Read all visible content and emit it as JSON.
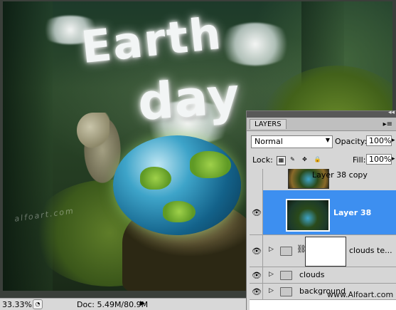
{
  "canvas": {
    "title_line1": "Earth",
    "title_line2": "day",
    "watermark": "alfoart.com"
  },
  "statusbar": {
    "zoom": "33.33%",
    "doc": "Doc: 5.49M/80.9M",
    "arrow": "▶"
  },
  "layers_panel": {
    "collapse_icon": "◂◂",
    "tab_label": "LAYERS",
    "menu_icon": "▸≡",
    "blend_mode": "Normal",
    "blend_caret": "▼",
    "opacity_label": "Opacity:",
    "opacity_value": "100%",
    "opacity_caret": "▸",
    "lock_label": "Lock:",
    "fill_label": "Fill:",
    "fill_value": "100%",
    "fill_caret": "▸",
    "layers": [
      {
        "name": "Layer 38 copy",
        "visible": false,
        "selected": false
      },
      {
        "name": "Layer 38",
        "visible": true,
        "selected": true
      },
      {
        "name": "clouds te...",
        "visible": true,
        "selected": false
      },
      {
        "name": "clouds",
        "visible": true,
        "selected": false
      },
      {
        "name": "background",
        "visible": true,
        "selected": false
      }
    ],
    "eye_glyph": "👁"
  },
  "footer_watermark": "www.Alfoart.com",
  "colors": {
    "selection": "#3d8ff0",
    "panel_bg": "#d6d6d6"
  }
}
